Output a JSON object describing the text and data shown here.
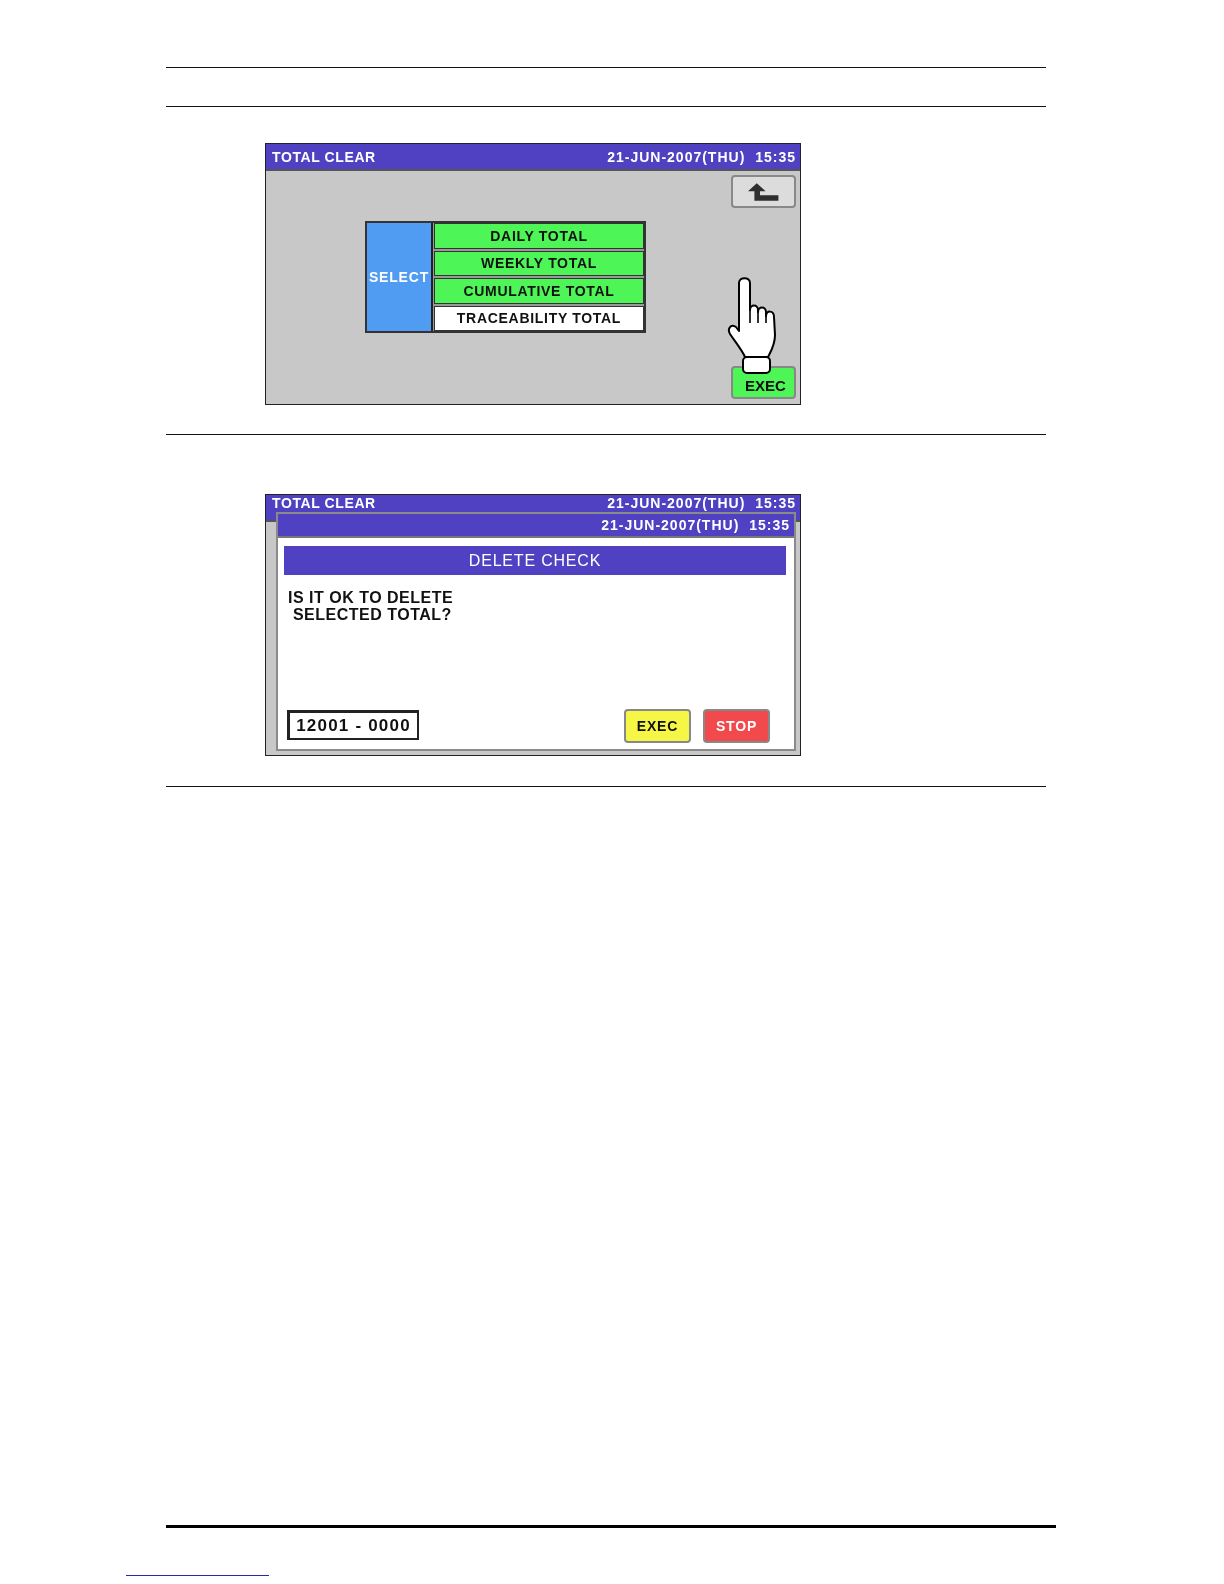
{
  "screens": [
    {
      "kind": "menu",
      "title": "TOTAL CLEAR",
      "datetime": "21-JUN-2007(THU) 15:35",
      "select_label": "SELECT",
      "options": [
        {
          "label": "DAILY TOTAL",
          "selected": true
        },
        {
          "label": "WEEKLY TOTAL",
          "selected": true
        },
        {
          "label": "CUMULATIVE TOTAL",
          "selected": true
        },
        {
          "label": "TRACEABILITY TOTAL",
          "selected": false
        }
      ],
      "exec_button": "EXEC"
    },
    {
      "kind": "confirm",
      "title": "TOTAL CLEAR",
      "datetime": "21-JUN-2007(THU) 15:35",
      "dialog": {
        "datetime": "21-JUN-2007(THU) 15:35",
        "heading": "DELETE CHECK",
        "message": "IS IT OK TO DELETE\n SELECTED TOTAL?",
        "code": "12001 - 0000",
        "buttons": [
          {
            "kind": "exec",
            "label": "EXEC"
          },
          {
            "kind": "stop",
            "label": "STOP"
          }
        ]
      }
    }
  ]
}
